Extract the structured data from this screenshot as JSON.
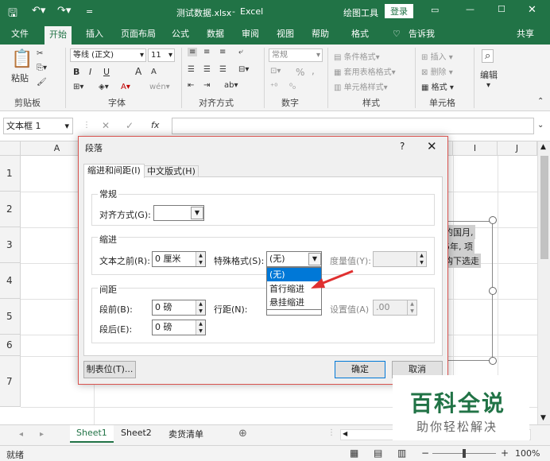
{
  "titlebar": {
    "filename": "测试数据.xlsx",
    "sep": "-",
    "app": "Excel",
    "context_tool": "绘图工具",
    "login": "登录"
  },
  "tabs": [
    "文件",
    "开始",
    "插入",
    "页面布局",
    "公式",
    "数据",
    "审阅",
    "视图",
    "帮助",
    "格式",
    "告诉我",
    "共享"
  ],
  "ribbon": {
    "clipboard": {
      "paste": "粘贴",
      "label": "剪贴板"
    },
    "font": {
      "name": "等线 (正文)",
      "size": "11",
      "label": "字体",
      "btns": [
        "B",
        "I",
        "U",
        "A",
        "A"
      ]
    },
    "align": {
      "label": "对齐方式"
    },
    "number": {
      "format": "常规",
      "label": "数字",
      "percent": "%",
      "comma": ","
    },
    "styles": {
      "cond": "条件格式",
      "table": "套用表格格式",
      "cell": "单元格样式",
      "label": "样式"
    },
    "cells": {
      "insert": "插入",
      "delete": "删除",
      "format": "格式",
      "label": "单元格"
    },
    "edit": {
      "label": "编辑"
    }
  },
  "formula": {
    "namebox": "文本框 1",
    "fx": "fx"
  },
  "columns": [
    "A",
    "I",
    "J"
  ],
  "rows": [
    "1",
    "2",
    "3",
    "4",
    "5",
    "6",
    "7"
  ],
  "cell_text": [
    "的国月,",
    "5年, 项",
    "购下选走"
  ],
  "sheets": [
    "Sheet1",
    "Sheet2",
    "卖货清单"
  ],
  "status": {
    "ready": "就绪",
    "zoom": "100%"
  },
  "dialog": {
    "title": "段落",
    "help": "?",
    "tabs": [
      "缩进和间距(I)",
      "中文版式(H)"
    ],
    "general": "常规",
    "align_label": "对齐方式(G):",
    "indent": "缩进",
    "before_text_label": "文本之前(R):",
    "before_text_value": "0 厘米",
    "special_label": "特殊格式(S):",
    "special_value": "(无)",
    "special_options": [
      "(无)",
      "首行缩进",
      "悬挂缩进"
    ],
    "measure_label": "度量值(Y):",
    "spacing": "间距",
    "before_label": "段前(B):",
    "before_value": "0 磅",
    "after_label": "段后(E):",
    "after_value": "0 磅",
    "line_label": "行距(N):",
    "setting_label": "设置值(A)",
    "setting_value": ".00",
    "tabs_btn": "制表位(T)...",
    "ok": "确定",
    "cancel": "取消"
  },
  "watermark": {
    "title": "百科全说",
    "sub": "助你轻松解决"
  },
  "colors": {
    "excel_green": "#217346",
    "arrow_red": "#e03030",
    "select_blue": "#0078d7"
  }
}
